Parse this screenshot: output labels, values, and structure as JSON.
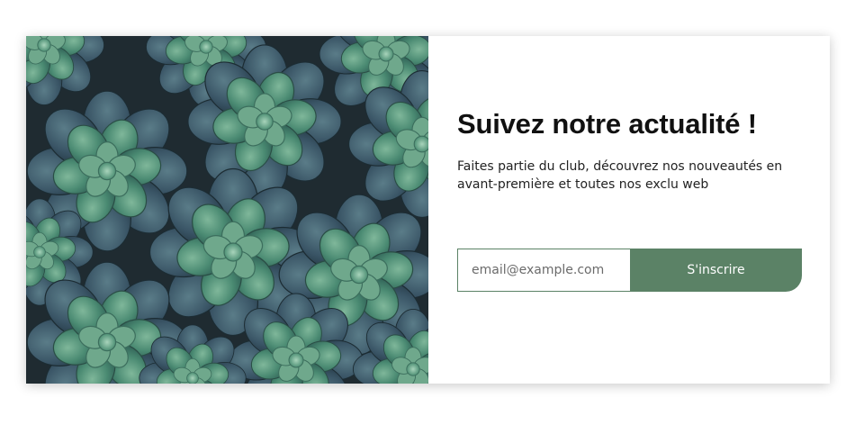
{
  "newsletter": {
    "title": "Suivez notre actualité !",
    "description": "Faites partie du club, découvrez nos nouveautés en avant-première et toutes nos exclu web",
    "email_placeholder": "email@example.com",
    "email_value": "",
    "submit_label": "S'inscrire",
    "image_subject": "succulent-plants-photo"
  },
  "colors": {
    "accent": "#5b8266",
    "title": "#111111",
    "text": "#222222",
    "photo_background": "#26343a"
  }
}
